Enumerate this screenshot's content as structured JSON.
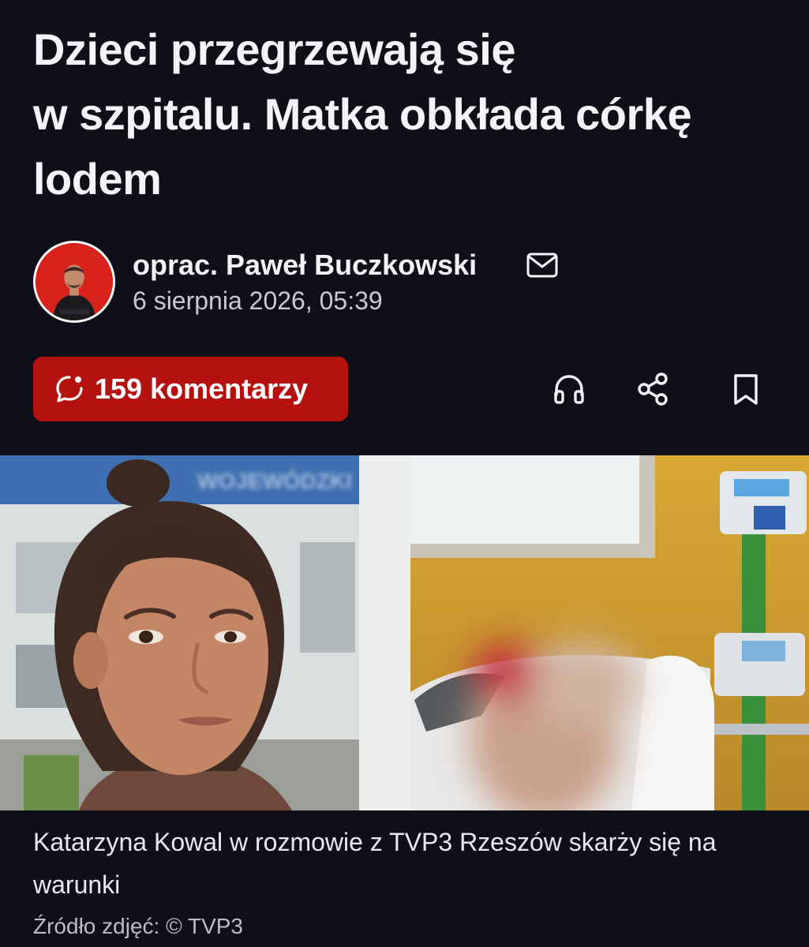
{
  "article": {
    "headline_line1": "Dzieci przegrzewają się",
    "headline_line2": "w szpitalu. Matka obkłada córkę",
    "headline_line3": "lodem"
  },
  "author": {
    "name": "oprac. Paweł Buczkowski",
    "date": "6 sierpnia 2026, 05:39",
    "avatar_icon": "author-avatar",
    "contact_icon": "mail-icon"
  },
  "actions": {
    "comments_label": "159 komentarzy",
    "comments_icon": "chat-bubble-icon",
    "listen_icon": "headphones-icon",
    "share_icon": "share-icon",
    "bookmark_icon": "bookmark-icon"
  },
  "photo": {
    "sign_text": "WOJEWÓDZKI"
  },
  "caption": {
    "text": "Katarzyna Kowal w rozmowie z TVP3 Rzeszów skarży się na warunki",
    "source": "Źródło zdjęć: © TVP3"
  },
  "colors": {
    "background": "#0f0f1a",
    "accent": "#b5120f",
    "text": "#f4f4f8"
  }
}
